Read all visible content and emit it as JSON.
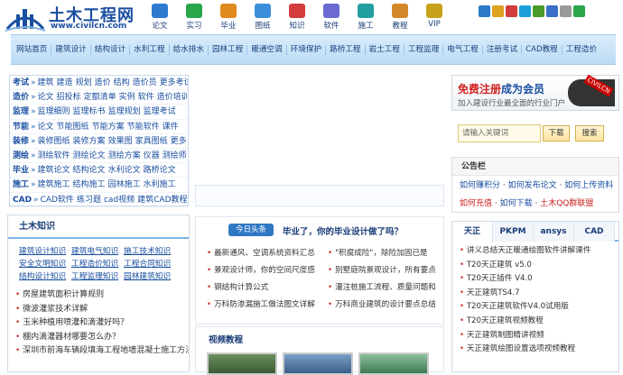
{
  "logo": {
    "name": "土木工程网",
    "url": "www.civilcn.com"
  },
  "top_nav": [
    {
      "label": "论文",
      "icon": "paper-icon",
      "color": "#2e7bd0"
    },
    {
      "label": "实习",
      "icon": "intern-icon",
      "color": "#2aa54a"
    },
    {
      "label": "毕业",
      "icon": "graduate-icon",
      "color": "#e08a1e"
    },
    {
      "label": "图纸",
      "icon": "drawing-icon",
      "color": "#3b8fd8"
    },
    {
      "label": "知识",
      "icon": "knowledge-icon",
      "color": "#d23c3c"
    },
    {
      "label": "软件",
      "icon": "software-icon",
      "color": "#6a6ad0"
    },
    {
      "label": "施工",
      "icon": "construction-icon",
      "color": "#22a0a0"
    },
    {
      "label": "教程",
      "icon": "tutorial-icon",
      "color": "#d6892a"
    },
    {
      "label": "VIP",
      "icon": "vip-icon",
      "color": "#c8a21a"
    }
  ],
  "social_colors": [
    "#2a7ac8",
    "#e0a020",
    "#d23c3c",
    "#1aa0d8",
    "#4a9a2a",
    "#3a6fc8",
    "#9a9a9a",
    "#2aa54a"
  ],
  "nav": [
    "网站首页",
    "建筑设计",
    "结构设计",
    "水利工程",
    "给水排水",
    "园林工程",
    "暖通空调",
    "环境保护",
    "路桥工程",
    "岩土工程",
    "工程监理",
    "电气工程",
    "注册考试",
    "CAD教程",
    "工程造价"
  ],
  "categories": [
    {
      "name": "考试",
      "items": [
        "建筑",
        "建造",
        "规划",
        "造价",
        "结构",
        "造价员",
        "更多考试"
      ]
    },
    {
      "name": "造价",
      "items": [
        "论文",
        "招投标",
        "定额清单",
        "实例",
        "软件",
        "造价培训"
      ]
    },
    {
      "name": "监理",
      "items": [
        "监理细则",
        "监理标书",
        "监理规划",
        "监理考试"
      ]
    },
    {
      "name": "节能",
      "items": [
        "论文",
        "节能图纸",
        "节能方案",
        "节能软件",
        "课件"
      ]
    },
    {
      "name": "装修",
      "items": [
        "装修图纸",
        "装修方案",
        "效果图",
        "家具图纸",
        "更多"
      ]
    },
    {
      "name": "测绘",
      "items": [
        "测绘软件",
        "测绘论文",
        "测绘方案",
        "仪器",
        "测绘师"
      ]
    },
    {
      "name": "毕业",
      "items": [
        "建筑论文",
        "结构论文",
        "水利论文",
        "路桥论文"
      ]
    },
    {
      "name": "施工",
      "items": [
        "建筑施工",
        "结构施工",
        "园林施工",
        "水利施工"
      ]
    },
    {
      "name": "CAD",
      "items": [
        "CAD软件",
        "练习题",
        "cad视频",
        "建筑CAD教程"
      ]
    }
  ],
  "ad": {
    "line1_red": "免费注册",
    "line1_blue": "成为会员",
    "line2": "加入建设行业最全面的行业门户",
    "badge": "CIVILCN"
  },
  "search": {
    "placeholder": "请输入关键词",
    "button1": "下载",
    "button2": "搜索"
  },
  "notice": {
    "title": "公告栏",
    "line1": [
      "如何赚积分",
      "如何发布论文",
      "如何上传资料"
    ],
    "line2": [
      "如何充值",
      "如何下载",
      "土木QQ群联盟"
    ]
  },
  "knowledge": {
    "title": "土木知识",
    "links": [
      "建筑设计知识",
      "建筑电气知识",
      "施工技术知识",
      "安全文明知识",
      "工程造价知识",
      "工程合同知识",
      "结构设计知识",
      "工程监理知识",
      "园林建筑知识"
    ],
    "articles": [
      "房屋建筑面积计算规则",
      "微波灌浆技术详解",
      "玉米种植用喷灌和滴灌好吗？",
      "棚内滴灌器材哪要怎么办？",
      "深圳市前海车辆段填海工程地墙混凝土施工方法比选"
    ]
  },
  "today": {
    "tag": "今日头条",
    "headline": "毕业了，你的毕业设计做了吗？",
    "rows": [
      [
        "最新通风、空调系统资料汇总",
        "\"积腐成险\"，除险加固已是"
      ],
      [
        "景观设计师，你的空间尺度感",
        "别墅庭院景观设计，所有要点"
      ],
      [
        "钢结构计算公式",
        "灌注桩施工流程、质量问题和"
      ],
      [
        "万科防渗漏施工做法图文详解",
        "万科商业建筑的设计要点总结"
      ]
    ]
  },
  "video": {
    "title": "视频教程"
  },
  "software": {
    "tabs": [
      "天正",
      "PKPM",
      "ansys",
      "CAD"
    ],
    "items": [
      "讲义总结天正暖通绘图软件讲解课件",
      "T20天正建筑 v5.0",
      "T20天正插件 V4.0",
      "天正建筑TS4.7",
      "T20天正建筑软件V4.0试用版",
      "T20天正建筑视频教程",
      "天正建筑制图精讲视频",
      "天正建筑绘图设置选项视频教程"
    ]
  }
}
